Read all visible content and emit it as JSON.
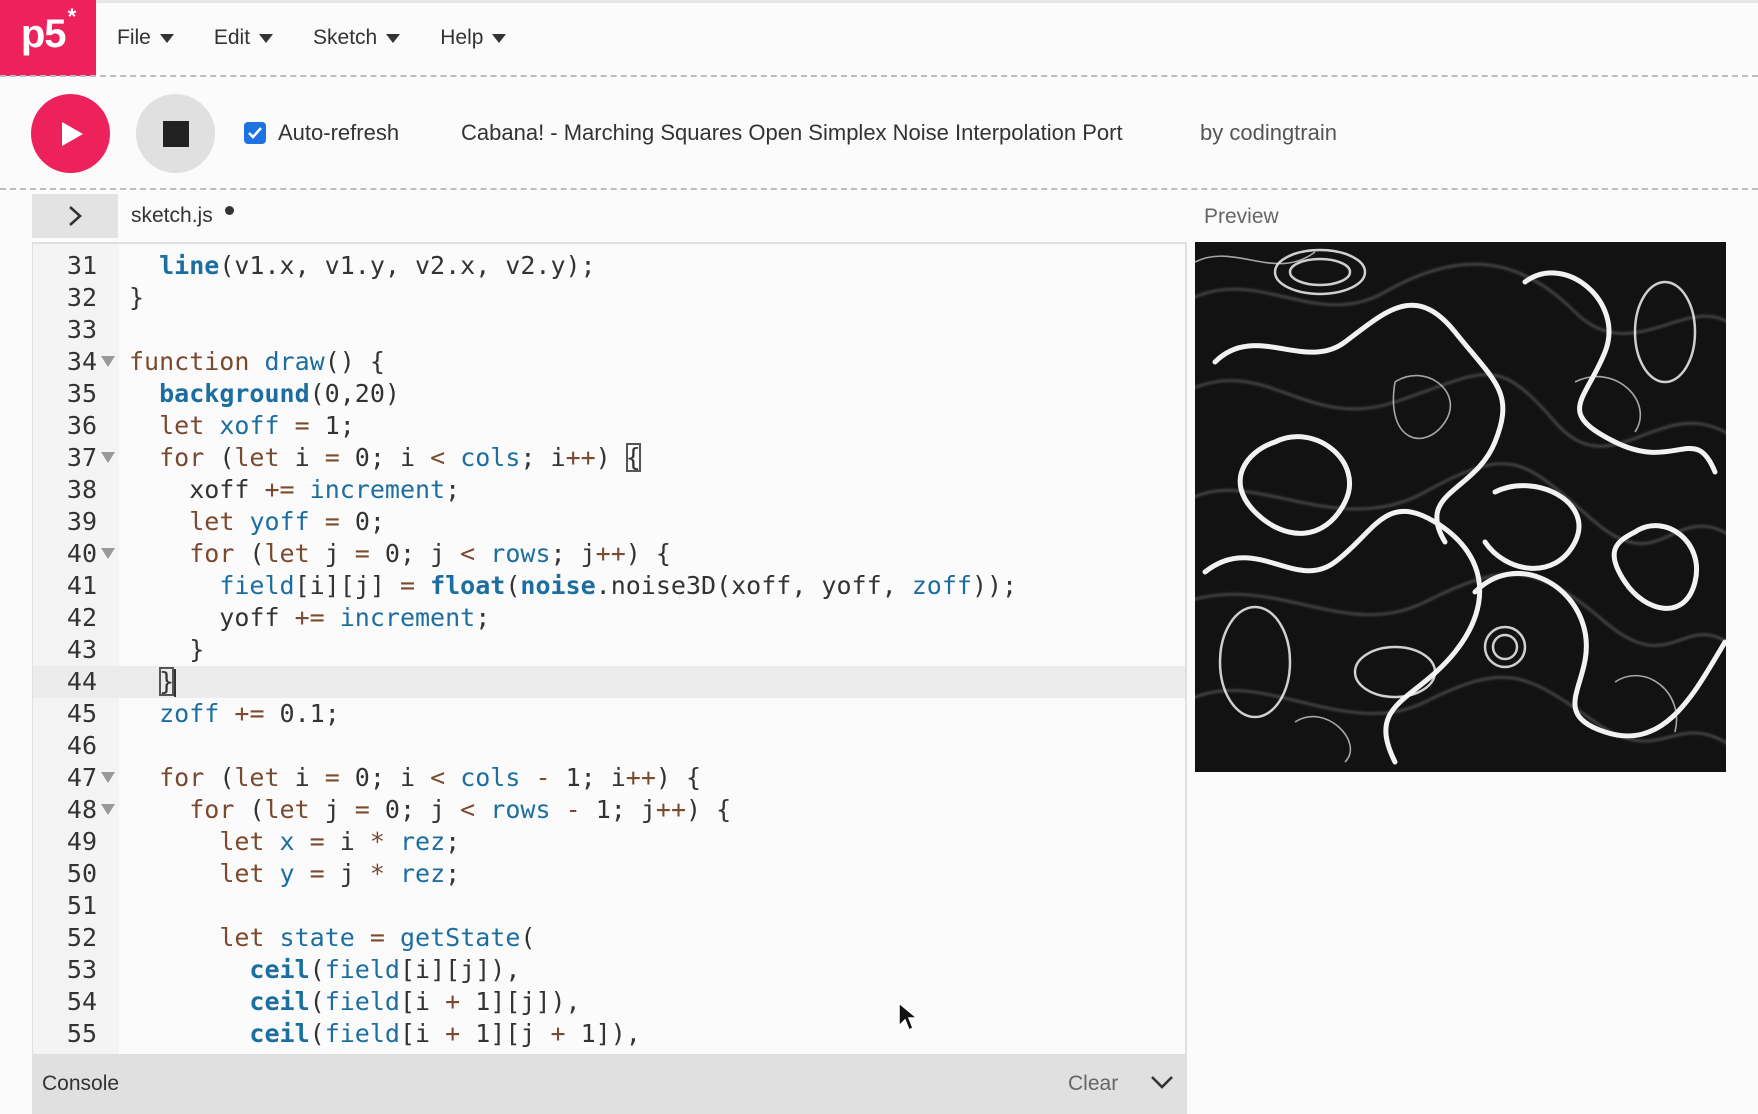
{
  "nav": {
    "logo_text": "p5",
    "logo_star": "*",
    "menu": [
      {
        "label": "File"
      },
      {
        "label": "Edit"
      },
      {
        "label": "Sketch"
      },
      {
        "label": "Help"
      }
    ]
  },
  "toolbar": {
    "play_icon": "play-icon",
    "stop_icon": "stop-icon",
    "auto_refresh_label": "Auto-refresh",
    "auto_refresh_checked": true,
    "sketch_title": "Cabana! - Marching Squares Open Simplex Noise Interpolation Port",
    "author": "by codingtrain"
  },
  "editor": {
    "file_tab": "sketch.js",
    "unsaved": true,
    "preview_label": "Preview",
    "lines": [
      {
        "n": "31"
      },
      {
        "n": "32"
      },
      {
        "n": "33"
      },
      {
        "n": "34"
      },
      {
        "n": "35"
      },
      {
        "n": "36"
      },
      {
        "n": "37"
      },
      {
        "n": "38"
      },
      {
        "n": "39"
      },
      {
        "n": "40"
      },
      {
        "n": "41"
      },
      {
        "n": "42"
      },
      {
        "n": "43"
      },
      {
        "n": "44"
      },
      {
        "n": "45"
      },
      {
        "n": "46"
      },
      {
        "n": "47"
      },
      {
        "n": "48"
      },
      {
        "n": "49"
      },
      {
        "n": "50"
      },
      {
        "n": "51"
      },
      {
        "n": "52"
      },
      {
        "n": "53"
      },
      {
        "n": "54"
      },
      {
        "n": "55"
      }
    ]
  },
  "console": {
    "title": "Console",
    "clear_label": "Clear"
  },
  "colors": {
    "brand": "#ed225d",
    "checkbox": "#1f73e0",
    "keyword": "#7a4a2f",
    "identifier": "#1d6ea0"
  }
}
